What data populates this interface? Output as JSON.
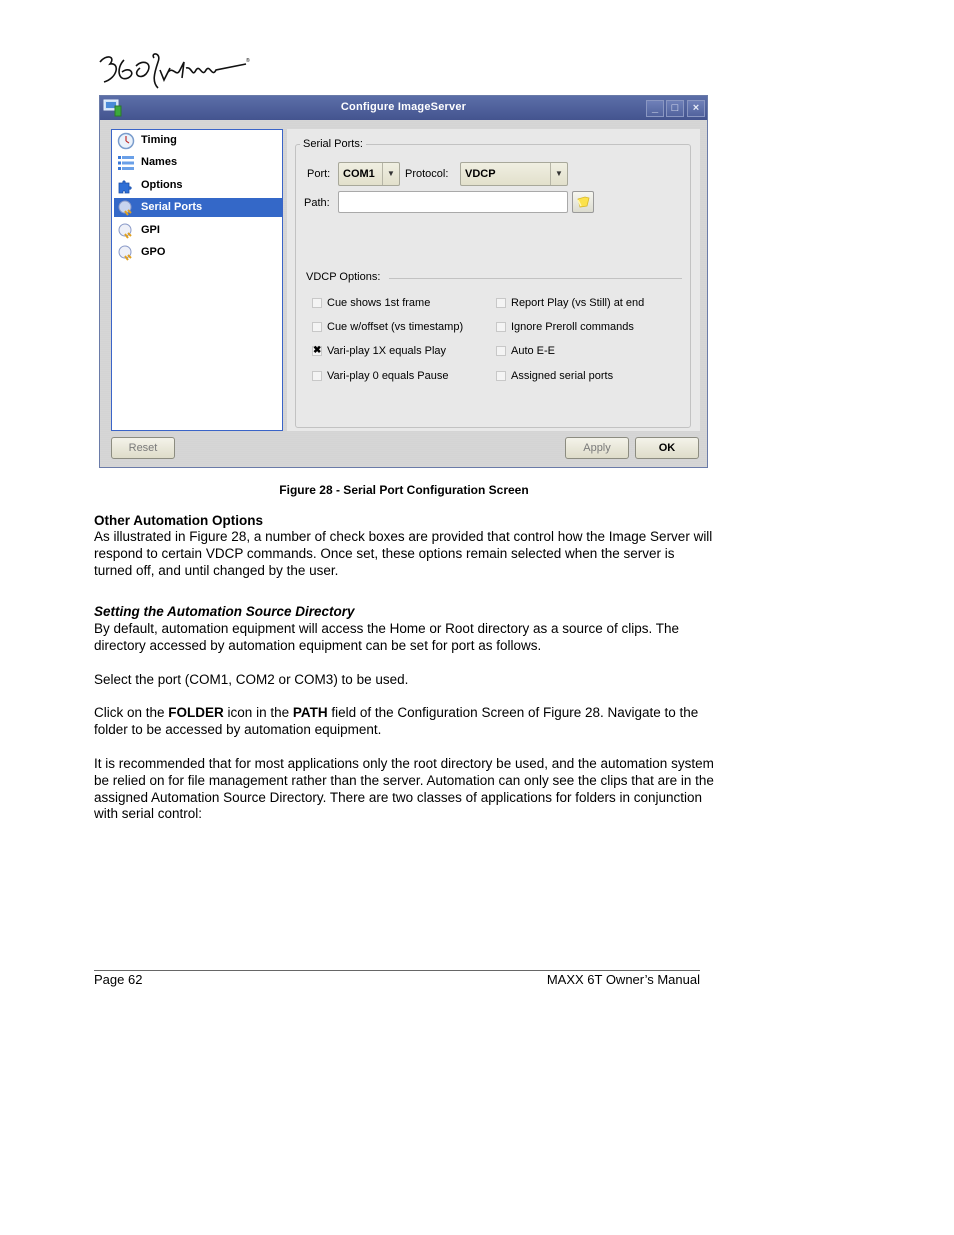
{
  "logo": {
    "text": "360 Systems",
    "icon": "brand-logo-icon"
  },
  "dialog": {
    "title": "Configure ImageServer",
    "window_buttons": {
      "minimize": "_",
      "maximize": "□",
      "close": "×"
    },
    "sidebar": {
      "items": [
        {
          "label": "Timing",
          "icon": "clock-icon",
          "selected": false
        },
        {
          "label": "Names",
          "icon": "list-icon",
          "selected": false
        },
        {
          "label": "Options",
          "icon": "puzzle-icon",
          "selected": false
        },
        {
          "label": "Serial Ports",
          "icon": "plug-icon",
          "selected": true
        },
        {
          "label": "GPI",
          "icon": "plug-icon",
          "selected": false
        },
        {
          "label": "GPO",
          "icon": "plug-icon",
          "selected": false
        }
      ]
    },
    "serial_ports": {
      "legend": "Serial Ports:",
      "port_label": "Port:",
      "port_value": "COM1",
      "protocol_label": "Protocol:",
      "protocol_value": "VDCP",
      "path_label": "Path:",
      "path_value": "",
      "folder_icon": "folder-icon"
    },
    "vdcp_options": {
      "legend": "VDCP Options:",
      "left": [
        {
          "label": "Cue shows 1st frame",
          "checked": false
        },
        {
          "label": "Cue w/offset (vs timestamp)",
          "checked": false
        },
        {
          "label": "Vari-play 1X equals Play",
          "checked": true
        },
        {
          "label": "Vari-play 0 equals Pause",
          "checked": false
        }
      ],
      "right": [
        {
          "label": "Report Play (vs Still) at end",
          "checked": false
        },
        {
          "label": "Ignore Preroll commands",
          "checked": false
        },
        {
          "label": "Auto E-E",
          "checked": false
        },
        {
          "label": "Assigned serial ports",
          "checked": false
        }
      ]
    },
    "buttons": {
      "reset": "Reset",
      "apply": "Apply",
      "ok": "OK"
    }
  },
  "document": {
    "caption": "Figure 28 - Serial Port Configuration Screen",
    "section1_heading": "Other Automation Options",
    "section1_para": "As illustrated in Figure 28, a number of check boxes are provided that control how the Image Server will respond to certain VDCP commands.  Once set, these options remain selected when the server is turned off, and until changed by the user.",
    "section2_heading": "Setting the Automation Source Directory",
    "section2_para1": "By default, automation equipment will access the Home or Root directory as a source of clips. The directory accessed by automation equipment can be set for port as follows.",
    "section2_para2": "Select the port (COM1, COM2 or COM3) to be used.",
    "section2_para3": {
      "t1": "Click on the ",
      "b1": "FOLDER",
      "t2": " icon in the ",
      "b2": "PATH",
      "t3": " field of the Configuration Screen of Figure 28. Navigate to the folder to be accessed by automation equipment."
    },
    "section2_para4": "It is recommended that for most applications only the root directory be used, and the automation system be relied on for file management rather than the server.  Automation can only see the clips that are in the assigned Automation Source Directory.  There are two classes of applications for folders in conjunction with serial control:"
  },
  "footer": {
    "page": "Page 62",
    "manual": "MAXX 6T Owner’s Manual"
  }
}
